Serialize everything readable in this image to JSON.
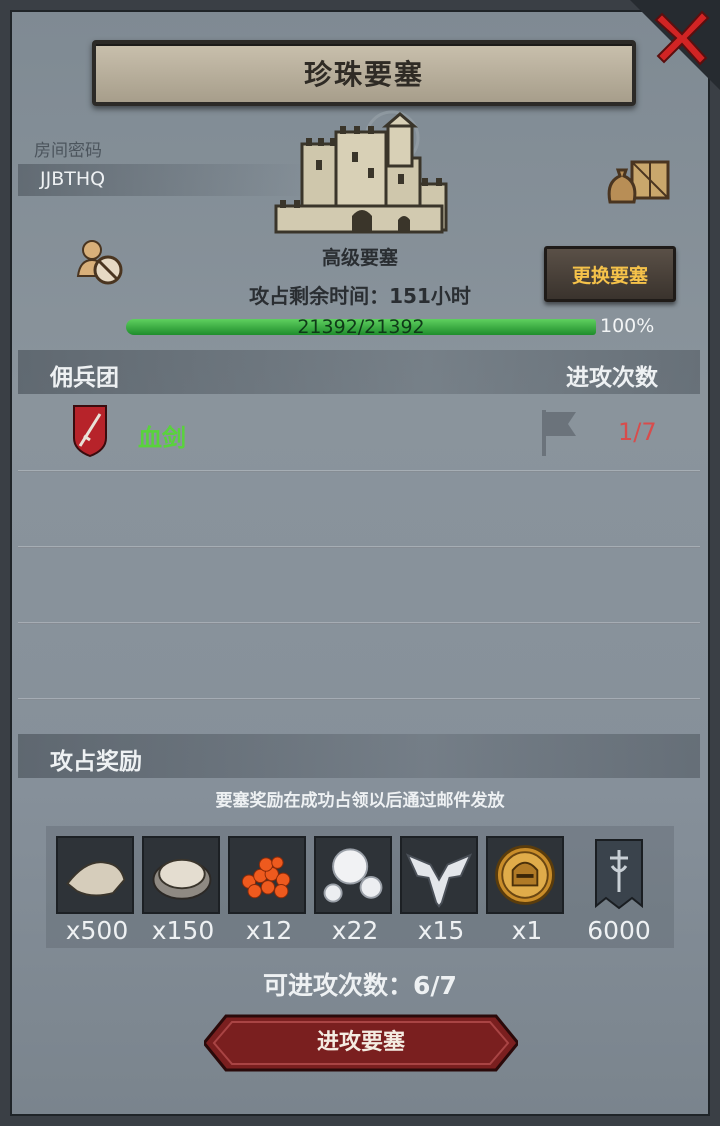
{
  "title": "珍珠要塞",
  "room": {
    "label": "房间密码",
    "code": "JJBTHQ"
  },
  "fortress": {
    "name": "高级要塞",
    "change_button": "更换要塞"
  },
  "remaining": {
    "label": "攻占剩余时间：",
    "value": "151",
    "unit": "小时"
  },
  "hp": {
    "text": "21392/21392",
    "percent_text": "100%",
    "fraction": 1.0
  },
  "table_headers": {
    "guild": "佣兵团",
    "attacks": "进攻次数"
  },
  "guilds": [
    {
      "name": "血剑",
      "attacks": "1/7"
    }
  ],
  "rewards": {
    "title": "攻占奖励",
    "note": "要塞奖励在成功占领以后通过邮件发放",
    "items": [
      {
        "icon": "salt-pile-icon",
        "qty": "x500"
      },
      {
        "icon": "oyster-icon",
        "qty": "x150"
      },
      {
        "icon": "fish-roe-icon",
        "qty": "x12"
      },
      {
        "icon": "pearl-icon",
        "qty": "x22"
      },
      {
        "icon": "wing-emblem-icon",
        "qty": "x15"
      },
      {
        "icon": "knight-helmet-coin-icon",
        "qty": "x1"
      },
      {
        "icon": "guild-banner-icon",
        "qty": "6000"
      }
    ]
  },
  "available_attacks": "可进攻次数：6/7",
  "attack_button": "进攻要塞",
  "colors": {
    "accent_gold": "#f5c24a",
    "guild_green": "#59d33c",
    "count_red": "#d84c4c",
    "hp_green": "#3bb54a"
  }
}
